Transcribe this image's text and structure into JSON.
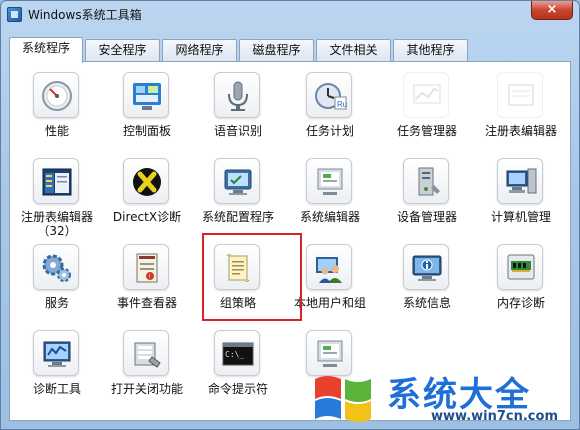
{
  "window": {
    "title": "Windows系统工具箱",
    "close_label": "×"
  },
  "tabs": [
    {
      "label": "系统程序",
      "active": true
    },
    {
      "label": "安全程序",
      "active": false
    },
    {
      "label": "网络程序",
      "active": false
    },
    {
      "label": "磁盘程序",
      "active": false
    },
    {
      "label": "文件相关",
      "active": false
    },
    {
      "label": "其他程序",
      "active": false
    }
  ],
  "tools": [
    {
      "label": "性能",
      "icon": "performance-gauge-icon"
    },
    {
      "label": "控制面板",
      "icon": "control-panel-icon"
    },
    {
      "label": "语音识别",
      "icon": "speech-recognition-icon"
    },
    {
      "label": "任务计划",
      "icon": "task-scheduler-icon"
    },
    {
      "label": "任务管理器",
      "icon": "task-manager-icon"
    },
    {
      "label": "注册表编辑器",
      "icon": "registry-editor-icon"
    },
    {
      "label": "注册表编辑器（32）",
      "icon": "registry-editor-32-icon"
    },
    {
      "label": "DirectX诊断",
      "icon": "directx-icon"
    },
    {
      "label": "系统配置程序",
      "icon": "system-config-icon"
    },
    {
      "label": "系统编辑器",
      "icon": "system-editor-icon"
    },
    {
      "label": "设备管理器",
      "icon": "device-manager-icon"
    },
    {
      "label": "计算机管理",
      "icon": "computer-management-icon"
    },
    {
      "label": "服务",
      "icon": "services-gear-icon"
    },
    {
      "label": "事件查看器",
      "icon": "event-viewer-icon"
    },
    {
      "label": "组策略",
      "icon": "group-policy-scroll-icon"
    },
    {
      "label": "本地用户和组",
      "icon": "local-users-icon"
    },
    {
      "label": "系统信息",
      "icon": "system-info-icon"
    },
    {
      "label": "内存诊断",
      "icon": "memory-diagnostics-icon"
    },
    {
      "label": "诊断工具",
      "icon": "diagnostic-tools-icon"
    },
    {
      "label": "打开关闭功能",
      "icon": "windows-features-icon"
    },
    {
      "label": "命令提示符",
      "icon": "command-prompt-icon"
    },
    {
      "label": "",
      "icon": "system-editor-icon"
    }
  ],
  "watermark": {
    "title": "系统大全",
    "url": "www.win7cn.com"
  },
  "colors": {
    "highlight": "#d9212a",
    "title_bar": "#bcd6f0",
    "watermark_blue": "#1e6fd6"
  }
}
